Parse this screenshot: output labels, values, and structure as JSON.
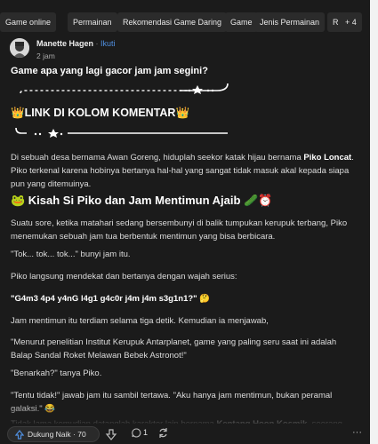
{
  "tags": [
    "Game online",
    "Permainan",
    "Rekomendasi Game Daring",
    "Game",
    "Jenis Permainan",
    "R"
  ],
  "tags_more": "+ 4",
  "author": {
    "name": "Manette Hagen",
    "separator": "·",
    "follow": "Ikuti",
    "time": "2 jam"
  },
  "post": {
    "question": "Game apa yang lagi gacor jam jam segini?",
    "link_banner": "👑LINK DI KOLOM KOMENTAR👑",
    "intro": "Di sebuah desa bernama Awan Goreng, hiduplah seekor katak hijau bernama Piko Loncat. Piko terkenal karena hobinya bertanya hal-hal yang sangat tidak masuk akal kepada siapa pun yang ditemuinya.",
    "heading": "🐸 Kisah Si Piko dan Jam Mentimun Ajaib 🥒⏰",
    "p1": "Suatu sore, ketika matahari sedang bersembunyi di balik tumpukan kerupuk terbang, Piko menemukan sebuah jam tua berbentuk mentimun yang bisa berbicara.",
    "p2": "\"Tok... tok... tok...\" bunyi jam itu.",
    "p3": "Piko langsung mendekat dan bertanya dengan wajah serius:",
    "code": "\"G4m3 4p4 y4nG l4g1 g4c0r j4m j4m s3g1n1?\" 🤔",
    "p4": "Jam mentimun itu terdiam selama tiga detik. Kemudian ia menjawab,",
    "p5": "\"Menurut penelitian Institut Kerupuk Antarplanet, game yang paling seru saat ini adalah Balap Sandal Roket Melawan Bebek Astronot!\"",
    "p6": "\"Benarkah?\" tanya Piko.",
    "p7": "\"Tentu tidak!\" jawab jam itu sambil tertawa. \"Aku hanya jam mentimun, bukan peramal galaksi.\" 😂",
    "p8": "Tidak lama kemudian datanglah karakter lain bernama Kentang Hoon Kosmik, seorang"
  },
  "actions": {
    "upvote_label": "Dukung Naik",
    "separator": "·",
    "upvote_count": "70",
    "comment_count": "1",
    "more": "···"
  },
  "icons": [
    "avatar",
    "upvote-icon",
    "downvote-icon",
    "comment-icon",
    "share-icon",
    "more-icon"
  ],
  "colors": {
    "background": "#1b1b1b",
    "link": "#4f8fe0",
    "text": "#dcdcdc"
  }
}
